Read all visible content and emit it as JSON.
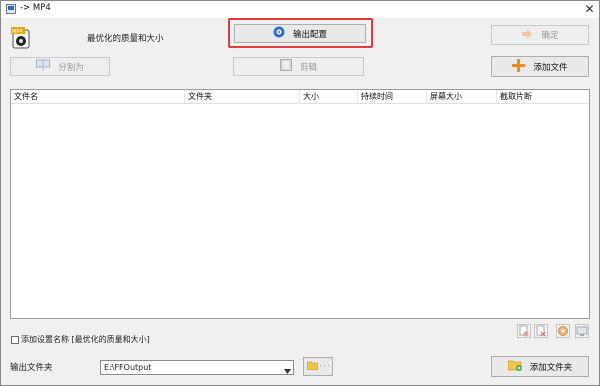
{
  "window": {
    "title": "-> MP4",
    "close_glyph": "✕"
  },
  "header": {
    "preset_label": "最优化的质量和大小",
    "output_settings_label": "输出配置",
    "ok_label": "确定"
  },
  "toolbar": {
    "split_label": "分割为",
    "clip_label": "剪辑",
    "add_file_label": "添加文件"
  },
  "table": {
    "columns": [
      "文件名",
      "文件夹",
      "大小",
      "持续时间",
      "屏幕大小",
      "截取片断"
    ],
    "rows": []
  },
  "footer": {
    "append_setting_label": "添加设置名称 [最优化的质量和大小]",
    "append_setting_checked": false,
    "output_folder_label": "输出文件夹",
    "output_folder_value": "E:\\FFOutput",
    "browse_dots": "· · ·",
    "add_folder_label": "添加文件夹"
  },
  "colors": {
    "highlight_frame": "#e23b3b",
    "add_plus": "#f08a1c"
  }
}
